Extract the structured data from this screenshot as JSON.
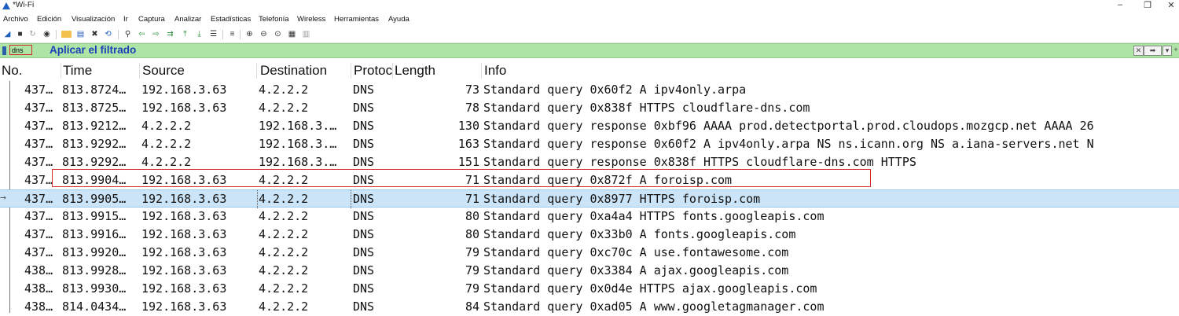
{
  "window": {
    "title": "*Wi-Fi",
    "minimize": "–",
    "maximize": "❐",
    "close": "✕"
  },
  "menu": [
    "Archivo",
    "Edición",
    "Visualización",
    "Ir",
    "Captura",
    "Analizar",
    "Estadísticas",
    "Telefonía",
    "Wireless",
    "Herramientas",
    "Ayuda"
  ],
  "toolbar_icons": [
    "shark-fin-start-icon",
    "stop-icon",
    "restart-icon",
    "capture-options-icon",
    "open-folder-icon",
    "save-file-icon",
    "close-file-icon",
    "reload-icon",
    "find-icon",
    "go-back-icon",
    "go-forward-icon",
    "go-to-packet-icon",
    "first-packet-icon",
    "last-packet-icon",
    "auto-scroll-icon",
    "colorize-icon",
    "zoom-in-icon",
    "zoom-out-icon",
    "zoom-normal-icon",
    "resize-columns-icon",
    "layout-icon"
  ],
  "filter": {
    "value": "dns",
    "apply_label": "Aplicar el filtrado"
  },
  "columns": {
    "no": "No.",
    "time": "Time",
    "source": "Source",
    "destination": "Destination",
    "protocol": "Protoc",
    "length": "Length",
    "info": "Info"
  },
  "packets": [
    {
      "no": "437…",
      "time": "813.8724…",
      "source": "192.168.3.63",
      "destination": "4.2.2.2",
      "protocol": "DNS",
      "length": "73",
      "info": "Standard query 0x60f2 A ipv4only.arpa"
    },
    {
      "no": "437…",
      "time": "813.8725…",
      "source": "192.168.3.63",
      "destination": "4.2.2.2",
      "protocol": "DNS",
      "length": "78",
      "info": "Standard query 0x838f HTTPS cloudflare-dns.com"
    },
    {
      "no": "437…",
      "time": "813.9212…",
      "source": "4.2.2.2",
      "destination": "192.168.3.…",
      "protocol": "DNS",
      "length": "130",
      "info": "Standard query response 0xbf96 AAAA prod.detectportal.prod.cloudops.mozgcp.net AAAA 26"
    },
    {
      "no": "437…",
      "time": "813.9292…",
      "source": "4.2.2.2",
      "destination": "192.168.3.…",
      "protocol": "DNS",
      "length": "163",
      "info": "Standard query response 0x60f2 A ipv4only.arpa NS ns.icann.org NS a.iana-servers.net N"
    },
    {
      "no": "437…",
      "time": "813.9292…",
      "source": "4.2.2.2",
      "destination": "192.168.3.…",
      "protocol": "DNS",
      "length": "151",
      "info": "Standard query response 0x838f HTTPS cloudflare-dns.com HTTPS"
    },
    {
      "no": "437…",
      "time": "813.9904…",
      "source": "192.168.3.63",
      "destination": "4.2.2.2",
      "protocol": "DNS",
      "length": "71",
      "info": "Standard query 0x872f A foroisp.com"
    },
    {
      "no": "437…",
      "time": "813.9905…",
      "source": "192.168.3.63",
      "destination": "4.2.2.2",
      "protocol": "DNS",
      "length": "71",
      "info": "Standard query 0x8977 HTTPS foroisp.com"
    },
    {
      "no": "437…",
      "time": "813.9915…",
      "source": "192.168.3.63",
      "destination": "4.2.2.2",
      "protocol": "DNS",
      "length": "80",
      "info": "Standard query 0xa4a4 HTTPS fonts.googleapis.com"
    },
    {
      "no": "437…",
      "time": "813.9916…",
      "source": "192.168.3.63",
      "destination": "4.2.2.2",
      "protocol": "DNS",
      "length": "80",
      "info": "Standard query 0x33b0 A fonts.googleapis.com"
    },
    {
      "no": "437…",
      "time": "813.9920…",
      "source": "192.168.3.63",
      "destination": "4.2.2.2",
      "protocol": "DNS",
      "length": "79",
      "info": "Standard query 0xc70c A use.fontawesome.com"
    },
    {
      "no": "438…",
      "time": "813.9928…",
      "source": "192.168.3.63",
      "destination": "4.2.2.2",
      "protocol": "DNS",
      "length": "79",
      "info": "Standard query 0x3384 A ajax.googleapis.com"
    },
    {
      "no": "438…",
      "time": "813.9930…",
      "source": "192.168.3.63",
      "destination": "4.2.2.2",
      "protocol": "DNS",
      "length": "79",
      "info": "Standard query 0x0d4e HTTPS ajax.googleapis.com"
    },
    {
      "no": "438…",
      "time": "814.0434…",
      "source": "192.168.3.63",
      "destination": "4.2.2.2",
      "protocol": "DNS",
      "length": "84",
      "info": "Standard query 0xad05 A www.googletagmanager.com"
    }
  ],
  "selected_index": 6,
  "colors": {
    "filter_ok": "#aee5a6",
    "selected_row": "#cce4f7",
    "annotation": "#d12b2b",
    "apply_text": "#1a3fb8"
  }
}
